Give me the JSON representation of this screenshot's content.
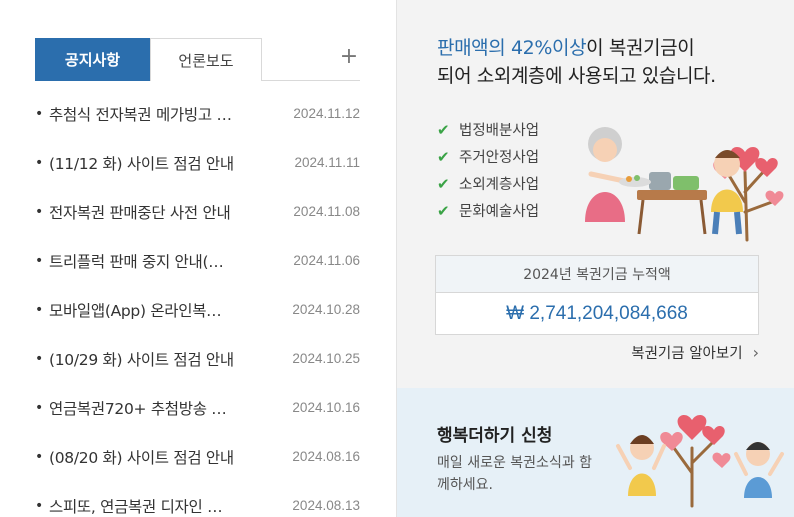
{
  "board": {
    "tabs": [
      {
        "label": "공지사항",
        "active": true
      },
      {
        "label": "언론보도",
        "active": false
      }
    ],
    "more_label": "+",
    "bullet": "•",
    "items": [
      {
        "title": "추첨식 전자복권 메가빙고 …",
        "date": "2024.11.12"
      },
      {
        "title": "(11/12 화) 사이트 점검 안내",
        "date": "2024.11.11"
      },
      {
        "title": "전자복권 판매중단 사전 안내",
        "date": "2024.11.08"
      },
      {
        "title": "트리플럭 판매 중지 안내(…",
        "date": "2024.11.06"
      },
      {
        "title": "모바일앱(App) 온라인복…",
        "date": "2024.10.28"
      },
      {
        "title": "(10/29 화) 사이트 점검 안내",
        "date": "2024.10.25"
      },
      {
        "title": "연금복권720+ 추첨방송 …",
        "date": "2024.10.16"
      },
      {
        "title": "(08/20 화) 사이트 점검 안내",
        "date": "2024.08.16"
      },
      {
        "title": "스피또, 연금복권 디자인 …",
        "date": "2024.08.13"
      }
    ]
  },
  "fund": {
    "heading_highlight": "판매액의 42%이상",
    "heading_rest_1": "이 복권기금이",
    "heading_line_2": "되어 소외계층에 사용되고 있습니다.",
    "uses": [
      "법정배분사업",
      "주거안정사업",
      "소외계층사업",
      "문화예술사업"
    ],
    "box_label": "2024년 복권기금 누적액",
    "box_amount": "₩ 2,741,204,084,668",
    "link_label": "복권기금 알아보기",
    "link_chevron": "›"
  },
  "happy": {
    "title": "행복더하기 신청",
    "desc": "매일 새로운 복권소식과 함께하세요."
  },
  "colors": {
    "accent": "#2b6ead",
    "check": "#3aa346",
    "panel_bg": "#f3f3f3",
    "happy_bg": "#e6f0f7"
  }
}
